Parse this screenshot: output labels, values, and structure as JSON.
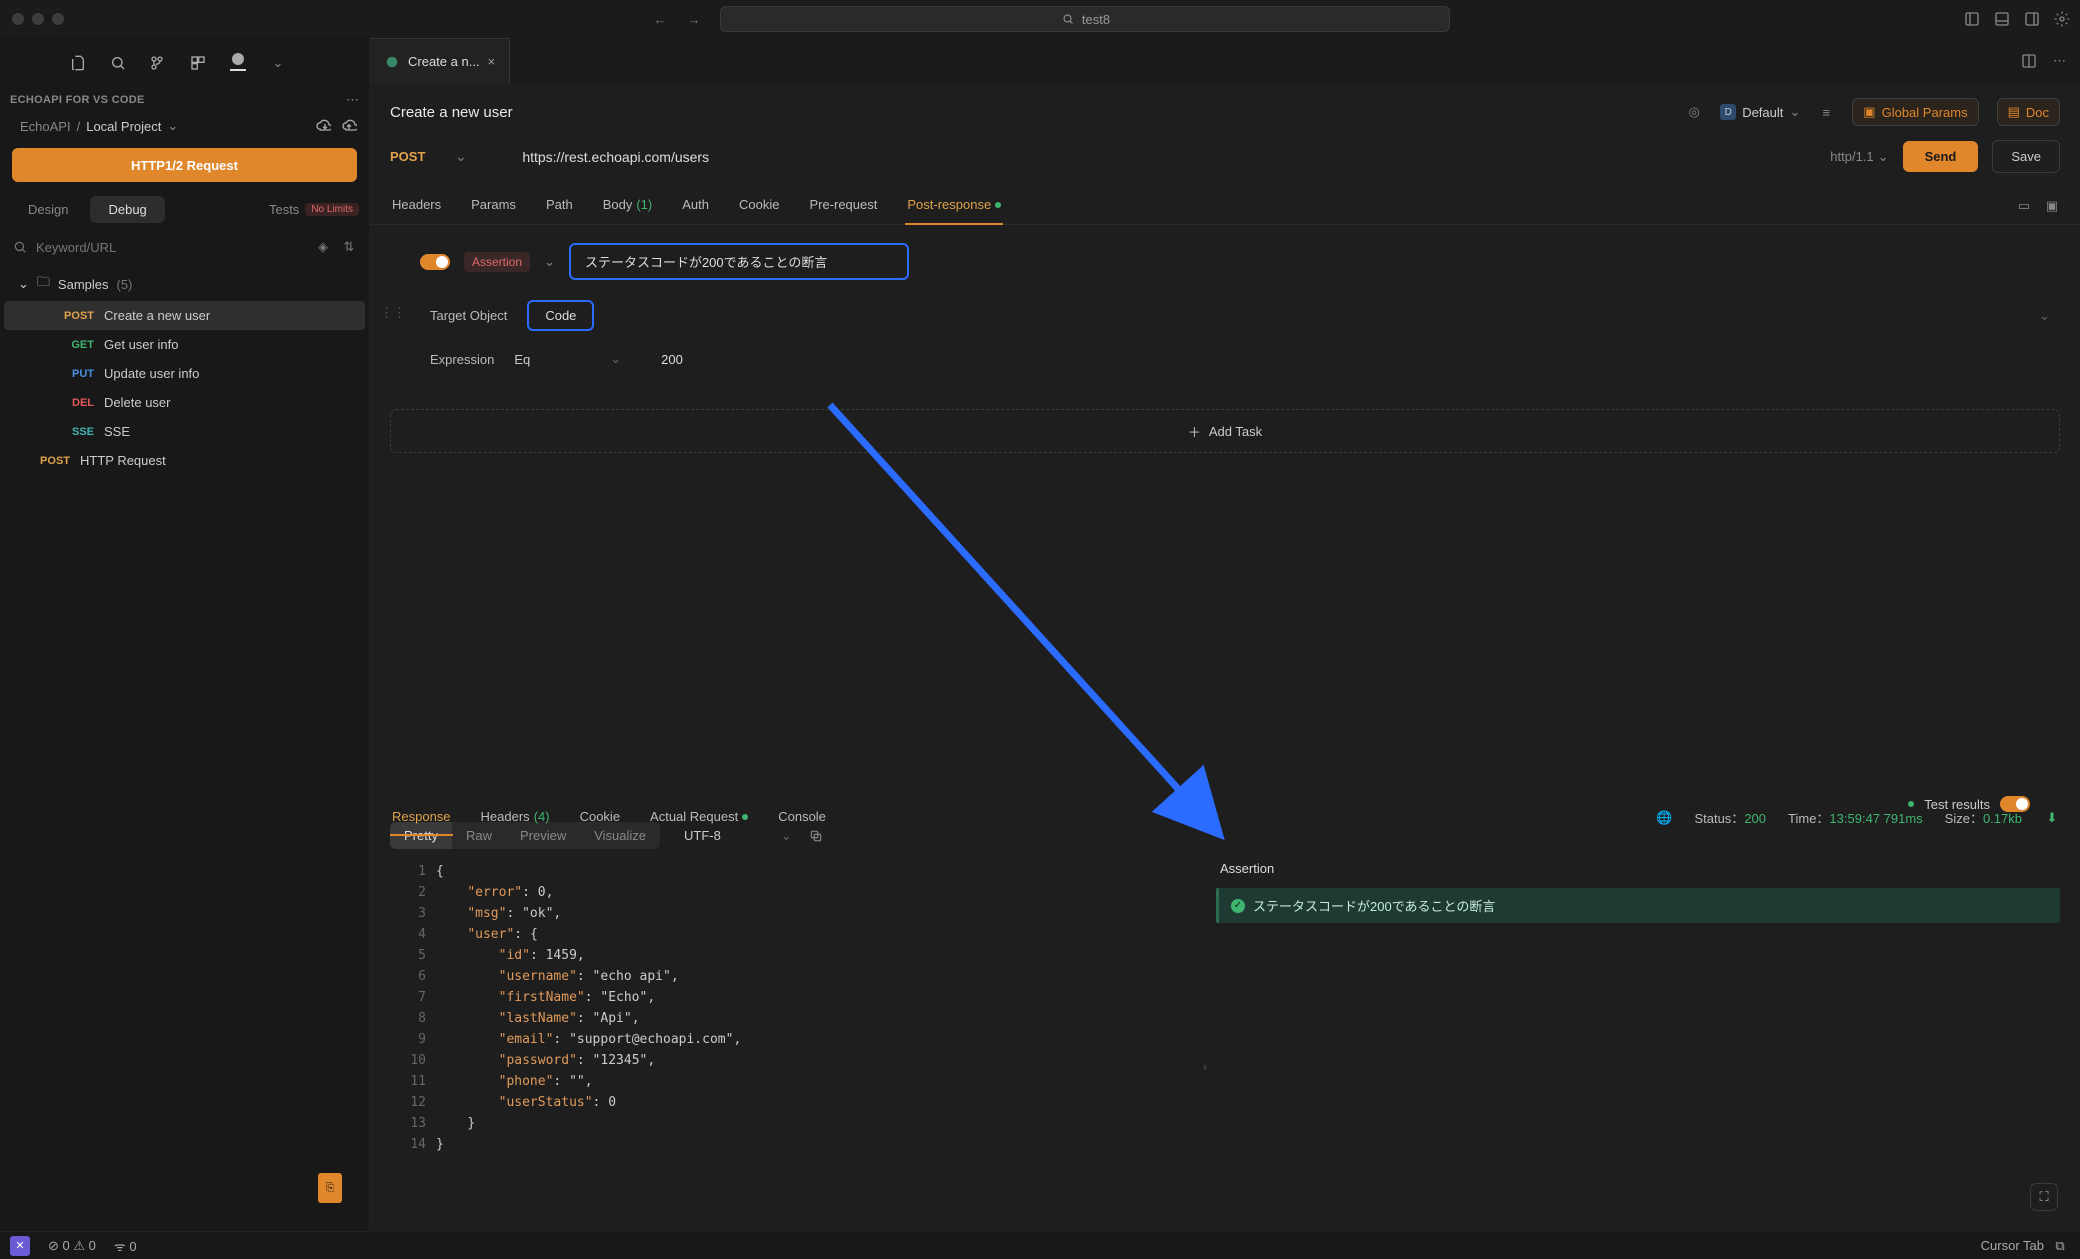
{
  "title_search": "test8",
  "extension_name": "ECHOAPI FOR VS CODE",
  "breadcrumb": {
    "root": "EchoAPI",
    "project": "Local Project"
  },
  "new_request_btn": "HTTP1/2 Request",
  "side_tabs": {
    "design": "Design",
    "debug": "Debug",
    "tests": "Tests",
    "tests_badge": "No Limits"
  },
  "filter_placeholder": "Keyword/URL",
  "tree": {
    "folder": "Samples",
    "folder_count": "(5)",
    "items": [
      {
        "method": "POST",
        "mClass": "m-post",
        "label": "Create a new user",
        "selected": true
      },
      {
        "method": "GET",
        "mClass": "m-get",
        "label": "Get user info"
      },
      {
        "method": "PUT",
        "mClass": "m-put",
        "label": "Update user info"
      },
      {
        "method": "DEL",
        "mClass": "m-del",
        "label": "Delete user"
      },
      {
        "method": "SSE",
        "mClass": "m-sse",
        "label": "SSE"
      }
    ],
    "top_item": {
      "method": "POST",
      "mClass": "m-post",
      "label": "HTTP Request"
    }
  },
  "tab_label": "Create a n...",
  "request": {
    "title": "Create a new user",
    "env": "Default",
    "global_params": "Global Params",
    "doc": "Doc",
    "method": "POST",
    "url": "https://rest.echoapi.com/users",
    "http_version": "http/1.1",
    "send": "Send",
    "save": "Save"
  },
  "req_tabs": [
    "Headers",
    "Params",
    "Path",
    "Body",
    "Auth",
    "Cookie",
    "Pre-request",
    "Post-response"
  ],
  "req_tab_body_count": "(1)",
  "req_tab_active": 7,
  "assertion": {
    "tag": "Assertion",
    "name": "ステータスコードが200であることの断言",
    "target_label": "Target Object",
    "target_value": "Code",
    "expr_label": "Expression",
    "expr_op": "Eq",
    "expr_val": "200",
    "add_task": "Add Task"
  },
  "response": {
    "tabs": [
      "Response",
      "Headers",
      "Cookie",
      "Actual Request",
      "Console"
    ],
    "headers_count": "(4)",
    "active": 0,
    "status_label": "Status：",
    "status_val": "200",
    "time_label": "Time：",
    "time_val": "13:59:47 791ms",
    "size_label": "Size：",
    "size_val": "0.17kb",
    "view_modes": [
      "Pretty",
      "Raw",
      "Preview",
      "Visualize"
    ],
    "encoding": "UTF-8",
    "test_results_label": "Test results",
    "assertion_section": "Assertion",
    "result_text": "ステータスコードが200であることの断言",
    "json_lines": [
      "{",
      "    \"error\": 0,",
      "    \"msg\": \"ok\",",
      "    \"user\": {",
      "        \"id\": 1459,",
      "        \"username\": \"echo api\",",
      "        \"firstName\": \"Echo\",",
      "        \"lastName\": \"Api\",",
      "        \"email\": \"support@echoapi.com\",",
      "        \"password\": \"12345\",",
      "        \"phone\": \"\",",
      "        \"userStatus\": 0",
      "    }",
      "}"
    ]
  },
  "statusbar": {
    "errors": "0",
    "warnings": "0",
    "ports": "0",
    "cursor_tab": "Cursor Tab"
  }
}
